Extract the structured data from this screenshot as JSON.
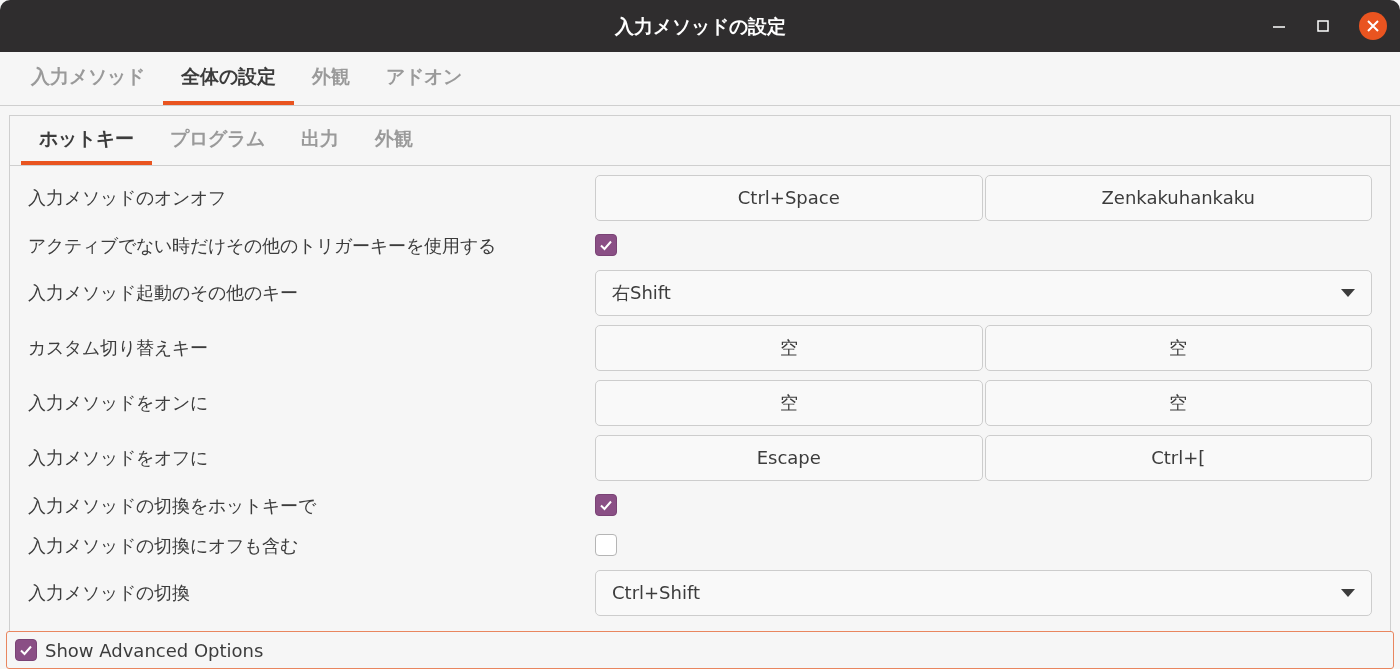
{
  "window": {
    "title": "入力メソッドの設定"
  },
  "tabs": [
    {
      "label": "入力メソッド",
      "selected": false
    },
    {
      "label": "全体の設定",
      "selected": true
    },
    {
      "label": "外観",
      "selected": false
    },
    {
      "label": "アドオン",
      "selected": false
    }
  ],
  "subtabs": [
    {
      "label": "ホットキー",
      "selected": true
    },
    {
      "label": "プログラム",
      "selected": false
    },
    {
      "label": "出力",
      "selected": false
    },
    {
      "label": "外観",
      "selected": false
    }
  ],
  "rows": [
    {
      "kind": "keys",
      "label": "入力メソッドのオンオフ",
      "keys": [
        "Ctrl+Space",
        "Zenkakuhankaku"
      ]
    },
    {
      "kind": "check",
      "label": "アクティブでない時だけその他のトリガーキーを使用する",
      "checked": true
    },
    {
      "kind": "select",
      "label": "入力メソッド起動のその他のキー",
      "value": "右Shift"
    },
    {
      "kind": "keys",
      "label": "カスタム切り替えキー",
      "keys": [
        "空",
        "空"
      ]
    },
    {
      "kind": "keys",
      "label": "入力メソッドをオンに",
      "keys": [
        "空",
        "空"
      ]
    },
    {
      "kind": "keys",
      "label": "入力メソッドをオフに",
      "keys": [
        "Escape",
        "Ctrl+["
      ]
    },
    {
      "kind": "check",
      "label": "入力メソッドの切換をホットキーで",
      "checked": true
    },
    {
      "kind": "check",
      "label": "入力メソッドの切換にオフも含む",
      "checked": false
    },
    {
      "kind": "select",
      "label": "入力メソッドの切換",
      "value": "Ctrl+Shift"
    }
  ],
  "advanced": {
    "label": "Show Advanced Options",
    "checked": true
  }
}
